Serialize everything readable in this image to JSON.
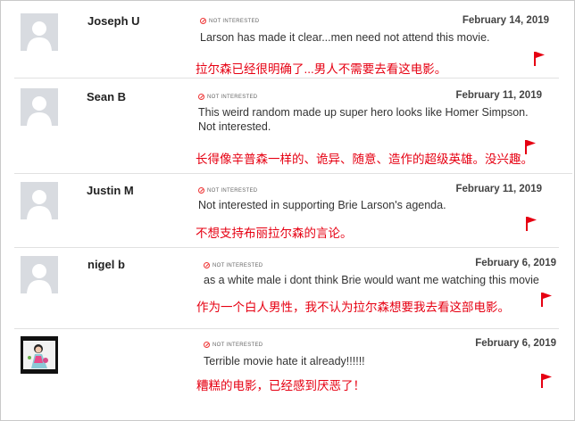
{
  "not_interested_label": "NOT INTERESTED",
  "colors": {
    "flag": "#e60012",
    "translation": "#e60012",
    "avatar_bg": "#d8dbe0"
  },
  "reviews": [
    {
      "username": "Joseph U",
      "date": "February 14, 2019",
      "comment": "Larson has made it clear...men need not attend this movie.",
      "translation": "拉尔森已经很明确了...男人不需要去看这电影。",
      "avatar": "default-avatar-icon"
    },
    {
      "username": "Sean B",
      "date": "February 11, 2019",
      "comment_line1": "This weird random made up super hero looks like Homer Simpson.",
      "comment_line2": "Not interested.",
      "translation": "长得像辛普森一样的、诡异、随意、造作的超级英雄。没兴趣。",
      "avatar": "default-avatar-icon"
    },
    {
      "username": "Justin M",
      "date": "February 11, 2019",
      "comment": "Not interested in supporting Brie Larson's agenda.",
      "translation": "不想支持布丽拉尔森的言论。",
      "avatar": "default-avatar-icon"
    },
    {
      "username": "nigel b",
      "date": "February 6, 2019",
      "comment": "as a white male i dont think Brie would want me watching this movie",
      "translation": "作为一个白人男性，我不认为拉尔森想要我去看这部电影。",
      "avatar": "default-avatar-icon"
    },
    {
      "username": "",
      "date": "February 6, 2019",
      "comment": "Terrible movie hate it already!!!!!!",
      "translation": "糟糕的电影，已经感到厌恶了！",
      "avatar": "user-photo"
    }
  ]
}
